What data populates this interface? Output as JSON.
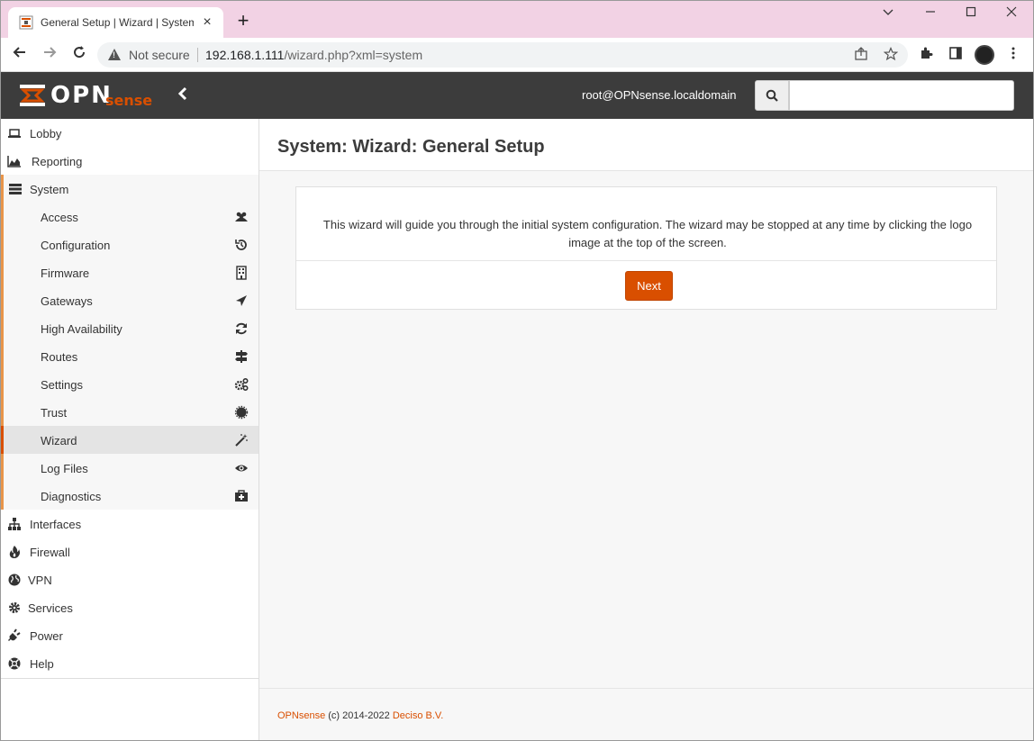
{
  "browser": {
    "tab_title": "General Setup | Wizard | System |",
    "new_tab": "+",
    "not_secure": "Not secure",
    "url_host": "192.168.1.111",
    "url_path": "/wizard.php?xml=system"
  },
  "header": {
    "logo_text": "OPN",
    "logo_sense": "sense",
    "user": "root@OPNsense.localdomain",
    "search_placeholder": ""
  },
  "sidebar": {
    "items": [
      {
        "label": "Lobby",
        "icon": "laptop-icon"
      },
      {
        "label": "Reporting",
        "icon": "area-chart-icon"
      },
      {
        "label": "System",
        "icon": "server-icon"
      }
    ],
    "system_sub": [
      {
        "label": "Access",
        "icon": "users-icon"
      },
      {
        "label": "Configuration",
        "icon": "history-icon"
      },
      {
        "label": "Firmware",
        "icon": "building-icon"
      },
      {
        "label": "Gateways",
        "icon": "location-arrow-icon"
      },
      {
        "label": "High Availability",
        "icon": "refresh-icon"
      },
      {
        "label": "Routes",
        "icon": "map-signs-icon"
      },
      {
        "label": "Settings",
        "icon": "cogs-icon"
      },
      {
        "label": "Trust",
        "icon": "certificate-icon"
      },
      {
        "label": "Wizard",
        "icon": "magic-icon"
      },
      {
        "label": "Log Files",
        "icon": "eye-icon"
      },
      {
        "label": "Diagnostics",
        "icon": "medkit-icon"
      }
    ],
    "bottom_items": [
      {
        "label": "Interfaces",
        "icon": "sitemap-icon"
      },
      {
        "label": "Firewall",
        "icon": "fire-icon"
      },
      {
        "label": "VPN",
        "icon": "globe-icon"
      },
      {
        "label": "Services",
        "icon": "cog-icon"
      },
      {
        "label": "Power",
        "icon": "plug-icon"
      },
      {
        "label": "Help",
        "icon": "life-ring-icon"
      }
    ]
  },
  "main": {
    "title": "System: Wizard: General Setup",
    "intro_line1": "This wizard will guide you through the initial system configuration. The wizard may be stopped at any time by clicking the logo",
    "intro_line2": "image at the top of the screen.",
    "next_label": "Next"
  },
  "footer": {
    "brand": "OPNsense",
    "copyright": " (c) 2014-2022 ",
    "company": "Deciso B.V."
  },
  "colors": {
    "accent": "#d94f00",
    "header_bg": "#3c3c3c",
    "submenu_border": "#e8954a",
    "titlebar_bg": "#f2d2e4"
  }
}
